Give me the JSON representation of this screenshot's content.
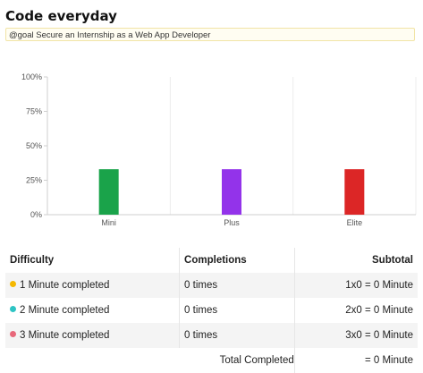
{
  "page": {
    "title": "Code everyday",
    "goal": "@goal Secure an Internship as a Web App Developer"
  },
  "chart_data": {
    "type": "bar",
    "categories": [
      "Mini",
      "Plus",
      "Elite"
    ],
    "values": [
      33,
      33,
      33
    ],
    "colors": [
      "#1aa34a",
      "#9333ea",
      "#dc2626"
    ],
    "ylim": [
      0,
      100
    ],
    "yticks": [
      "0%",
      "25%",
      "50%",
      "75%",
      "100%"
    ],
    "ytick_values": [
      0,
      25,
      50,
      75,
      100
    ],
    "grid": "vertical",
    "title": "",
    "xlabel": "",
    "ylabel": ""
  },
  "table": {
    "headers": [
      "Difficulty",
      "Completions",
      "Subtotal"
    ],
    "rows": [
      {
        "dot_color": "#f5b800",
        "difficulty": "1 Minute completed",
        "completions": "0 times",
        "subtotal": "1x0 = 0 Minute"
      },
      {
        "dot_color": "#2ec4c4",
        "difficulty": "2 Minute completed",
        "completions": "0 times",
        "subtotal": "2x0 = 0 Minute"
      },
      {
        "dot_color": "#e8687a",
        "difficulty": "3 Minute completed",
        "completions": "0 times",
        "subtotal": "3x0 = 0 Minute"
      }
    ],
    "total_label": "Total Completed",
    "total_value": "= 0 Minute"
  }
}
